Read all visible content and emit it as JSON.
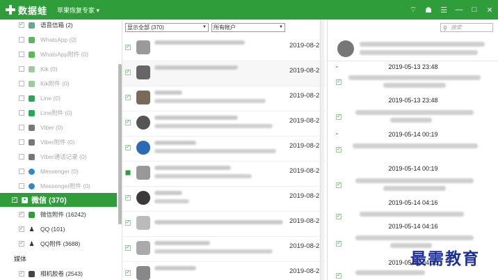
{
  "titlebar": {
    "app_name": "数据蛙",
    "subtitle": "苹果恢复专家 ▾",
    "icons": [
      "wifi-icon",
      "shirt-icon",
      "menu-icon",
      "minimize-icon",
      "maximize-icon",
      "close-icon"
    ],
    "icon_glyphs": [
      "⌔",
      "☗",
      "☰",
      "—",
      "□",
      "✕"
    ]
  },
  "sidebar": {
    "items": [
      {
        "label": "语音信箱 (2)",
        "checked": true
      },
      {
        "label": "WhatsApp (0)",
        "checked": false
      },
      {
        "label": "WhatsApp附件 (0)",
        "checked": false
      },
      {
        "label": "Kik (0)",
        "checked": false
      },
      {
        "label": "Kik附件 (0)",
        "checked": false
      },
      {
        "label": "Line (0)",
        "checked": false
      },
      {
        "label": "Line附件 (0)",
        "checked": false
      },
      {
        "label": "Viber (0)",
        "checked": false
      },
      {
        "label": "Viber附件 (0)",
        "checked": false
      },
      {
        "label": "Viber通话记录 (0)",
        "checked": false
      },
      {
        "label": "Messenger (0)",
        "checked": false
      },
      {
        "label": "Messenger附件 (0)",
        "checked": false
      },
      {
        "label": "微信 (370)",
        "checked": true
      },
      {
        "label": "微信附件 (16242)",
        "checked": true
      },
      {
        "label": "QQ (101)",
        "checked": true
      },
      {
        "label": "QQ附件 (3688)",
        "checked": true
      }
    ],
    "group_media": "媒体",
    "media_items": [
      {
        "label": "相机胶卷 (2543)",
        "checked": true
      }
    ]
  },
  "middle": {
    "filter_show": "显示全部 (370)",
    "filter_account": "所有帐户",
    "rows": [
      {
        "date": "2019-08-2"
      },
      {
        "date": "2019-08-2"
      },
      {
        "date": "2019-08-2"
      },
      {
        "date": "2019-08-2"
      },
      {
        "date": "2019-08-2"
      },
      {
        "date": "2019-08-2"
      },
      {
        "date": "2019-08-2"
      },
      {
        "date": "2019-08-2"
      },
      {
        "date": "2019-08-2"
      },
      {
        "date": "2019-08-2"
      }
    ]
  },
  "chat": {
    "search_placeholder": "搜索",
    "times": [
      "2019-05-13 23:48",
      "2019-05-13 23:48",
      "2019-05-14 00:19",
      "2019-05-14 00:19",
      "2019-05-14 04:16",
      "2019-05-14 04:16",
      "2019-05-14 04:16"
    ]
  },
  "watermark": "最需教育",
  "colors": {
    "brand_green": "#2f9d3a",
    "watermark_blue": "#1c2f9e"
  }
}
